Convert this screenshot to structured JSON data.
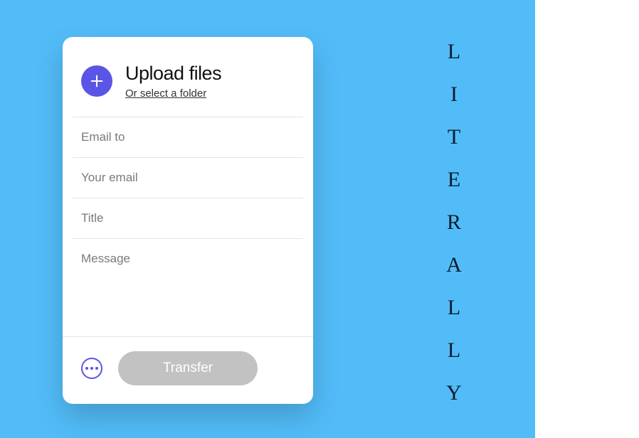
{
  "card": {
    "upload_title": "Upload files",
    "upload_subtitle": "Or select a folder",
    "fields": {
      "email_to_placeholder": "Email to",
      "your_email_placeholder": "Your email",
      "title_placeholder": "Title",
      "message_placeholder": "Message"
    },
    "transfer_label": "Transfer"
  },
  "side_word": {
    "letters": [
      "L",
      "I",
      "T",
      "E",
      "R",
      "A",
      "L",
      "L",
      "Y"
    ]
  },
  "icons": {
    "plus": "plus-icon",
    "more": "more-icon"
  },
  "colors": {
    "accent": "#5a55e6",
    "bg_blue": "#52bcf8",
    "disabled": "#c2c2c2"
  }
}
